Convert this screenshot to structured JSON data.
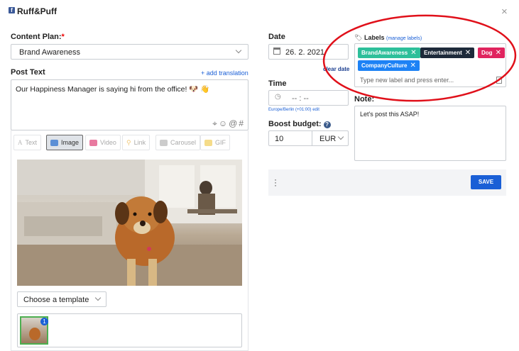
{
  "app": {
    "title": "Ruff&Puff"
  },
  "content_plan": {
    "label": "Content Plan:",
    "required_mark": "*",
    "value": "Brand Awareness"
  },
  "post_text": {
    "label": "Post Text",
    "add_translation": "+ add translation",
    "value": "Our Happiness Manager is saying hi from the office! 🐶 👋"
  },
  "media_tabs": [
    {
      "label": "Text",
      "icon": "text-icon",
      "active": false
    },
    {
      "label": "Image",
      "icon": "image-icon",
      "active": true
    },
    {
      "label": "Video",
      "icon": "video-icon",
      "active": false
    },
    {
      "label": "Link",
      "icon": "link-icon",
      "active": false
    },
    {
      "label": "Carousel",
      "icon": "carousel-icon",
      "active": false
    },
    {
      "label": "GIF",
      "icon": "gif-icon",
      "active": false
    }
  ],
  "template": {
    "value": "Choose a template"
  },
  "thumbnail": {
    "badge": "1"
  },
  "date": {
    "label": "Date",
    "value": "26. 2. 2021",
    "clear": "clear date"
  },
  "time": {
    "label": "Time",
    "value": "-- : --",
    "timezone": "Europe/Berlin (+01:00) edit"
  },
  "boost": {
    "label": "Boost budget:",
    "amount": "10",
    "currency": "EUR"
  },
  "labels": {
    "label": "Labels",
    "manage": "(manage labels)",
    "chips": [
      {
        "text": "BrandAwareness",
        "color": "#2dbf9a"
      },
      {
        "text": "Entertainment",
        "color": "#1d2a3a"
      },
      {
        "text": "Dog",
        "color": "#e0245e"
      },
      {
        "text": "CompanyCulture",
        "color": "#1d82f5"
      }
    ],
    "placeholder": "Type new label and press enter..."
  },
  "note": {
    "label": "Note:",
    "value": "Let's post this ASAP!"
  },
  "save_button": "SAVE",
  "colors": {
    "accent": "#1a5fd6",
    "annotation": "#e0101a",
    "brand": "#3b5998"
  }
}
